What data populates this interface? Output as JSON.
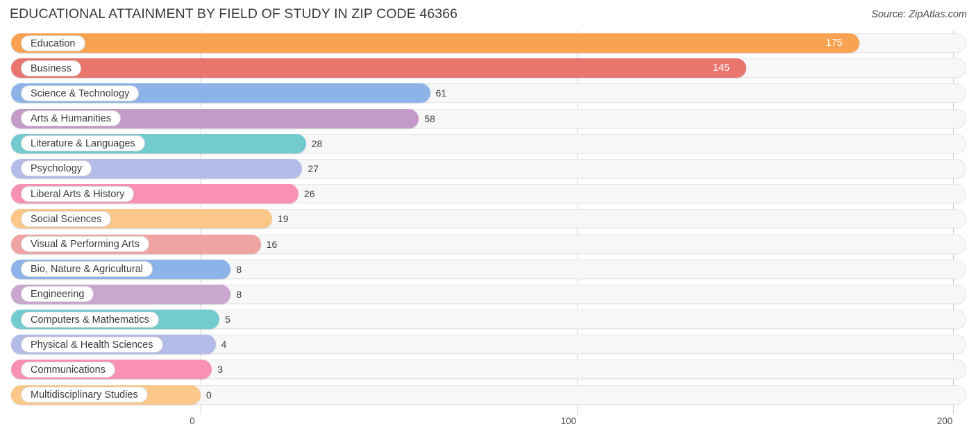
{
  "header": {
    "title": "EDUCATIONAL ATTAINMENT BY FIELD OF STUDY IN ZIP CODE 46366",
    "source": "Source: ZipAtlas.com"
  },
  "chart_data": {
    "type": "bar",
    "orientation": "horizontal",
    "title": "EDUCATIONAL ATTAINMENT BY FIELD OF STUDY IN ZIP CODE 46366",
    "xlabel": "",
    "ylabel": "",
    "xlim": [
      0,
      200
    ],
    "xticks": [
      "0",
      "100",
      "200"
    ],
    "xtick_values": [
      0,
      100,
      200
    ],
    "grid": true,
    "legend": false,
    "categories": [
      "Education",
      "Business",
      "Science & Technology",
      "Arts & Humanities",
      "Literature & Languages",
      "Psychology",
      "Liberal Arts & History",
      "Social Sciences",
      "Visual & Performing Arts",
      "Bio, Nature & Agricultural",
      "Engineering",
      "Computers & Mathematics",
      "Physical & Health Sciences",
      "Communications",
      "Multidisciplinary Studies"
    ],
    "values": [
      175,
      145,
      61,
      58,
      28,
      27,
      26,
      19,
      16,
      8,
      8,
      5,
      4,
      3,
      0
    ],
    "value_labels": [
      "175",
      "145",
      "61",
      "58",
      "28",
      "27",
      "26",
      "19",
      "16",
      "8",
      "8",
      "5",
      "4",
      "3",
      "0"
    ],
    "colors": [
      "#f9a košt",
      "#e8766f",
      "#8cb4e8",
      "#c49bc8",
      "#72cbce",
      "#b3bce8",
      "#f991b4",
      "#fbc88a",
      "#efa3a3",
      "#8cb4e8",
      "#c9a7ce",
      "#72cbce",
      "#b3bce8",
      "#f991b4",
      "#fbc88a"
    ]
  },
  "bars": [
    {
      "label": "Education",
      "value": 175,
      "value_label": "175",
      "color": "#f9a352",
      "inside": true
    },
    {
      "label": "Business",
      "value": 145,
      "value_label": "145",
      "color": "#e8766f",
      "inside": true
    },
    {
      "label": "Science & Technology",
      "value": 61,
      "value_label": "61",
      "color": "#8cb4e8",
      "inside": false
    },
    {
      "label": "Arts & Humanities",
      "value": 58,
      "value_label": "58",
      "color": "#c49bc8",
      "inside": false
    },
    {
      "label": "Literature & Languages",
      "value": 28,
      "value_label": "28",
      "color": "#72cbce",
      "inside": false
    },
    {
      "label": "Psychology",
      "value": 27,
      "value_label": "27",
      "color": "#b3bce8",
      "inside": false
    },
    {
      "label": "Liberal Arts & History",
      "value": 26,
      "value_label": "26",
      "color": "#f991b4",
      "inside": false
    },
    {
      "label": "Social Sciences",
      "value": 19,
      "value_label": "19",
      "color": "#fbc88a",
      "inside": false
    },
    {
      "label": "Visual & Performing Arts",
      "value": 16,
      "value_label": "16",
      "color": "#efa3a3",
      "inside": false
    },
    {
      "label": "Bio, Nature & Agricultural",
      "value": 8,
      "value_label": "8",
      "color": "#8cb4e8",
      "inside": false
    },
    {
      "label": "Engineering",
      "value": 8,
      "value_label": "8",
      "color": "#c9a7ce",
      "inside": false
    },
    {
      "label": "Computers & Mathematics",
      "value": 5,
      "value_label": "5",
      "color": "#72cbce",
      "inside": false
    },
    {
      "label": "Physical & Health Sciences",
      "value": 4,
      "value_label": "4",
      "color": "#b3bce8",
      "inside": false
    },
    {
      "label": "Communications",
      "value": 3,
      "value_label": "3",
      "color": "#f991b4",
      "inside": false
    },
    {
      "label": "Multidisciplinary Studies",
      "value": 0,
      "value_label": "0",
      "color": "#fbc88a",
      "inside": false
    }
  ],
  "axis": {
    "ticks": [
      {
        "label": "0",
        "value": 0
      },
      {
        "label": "100",
        "value": 100
      },
      {
        "label": "200",
        "value": 200
      }
    ]
  }
}
